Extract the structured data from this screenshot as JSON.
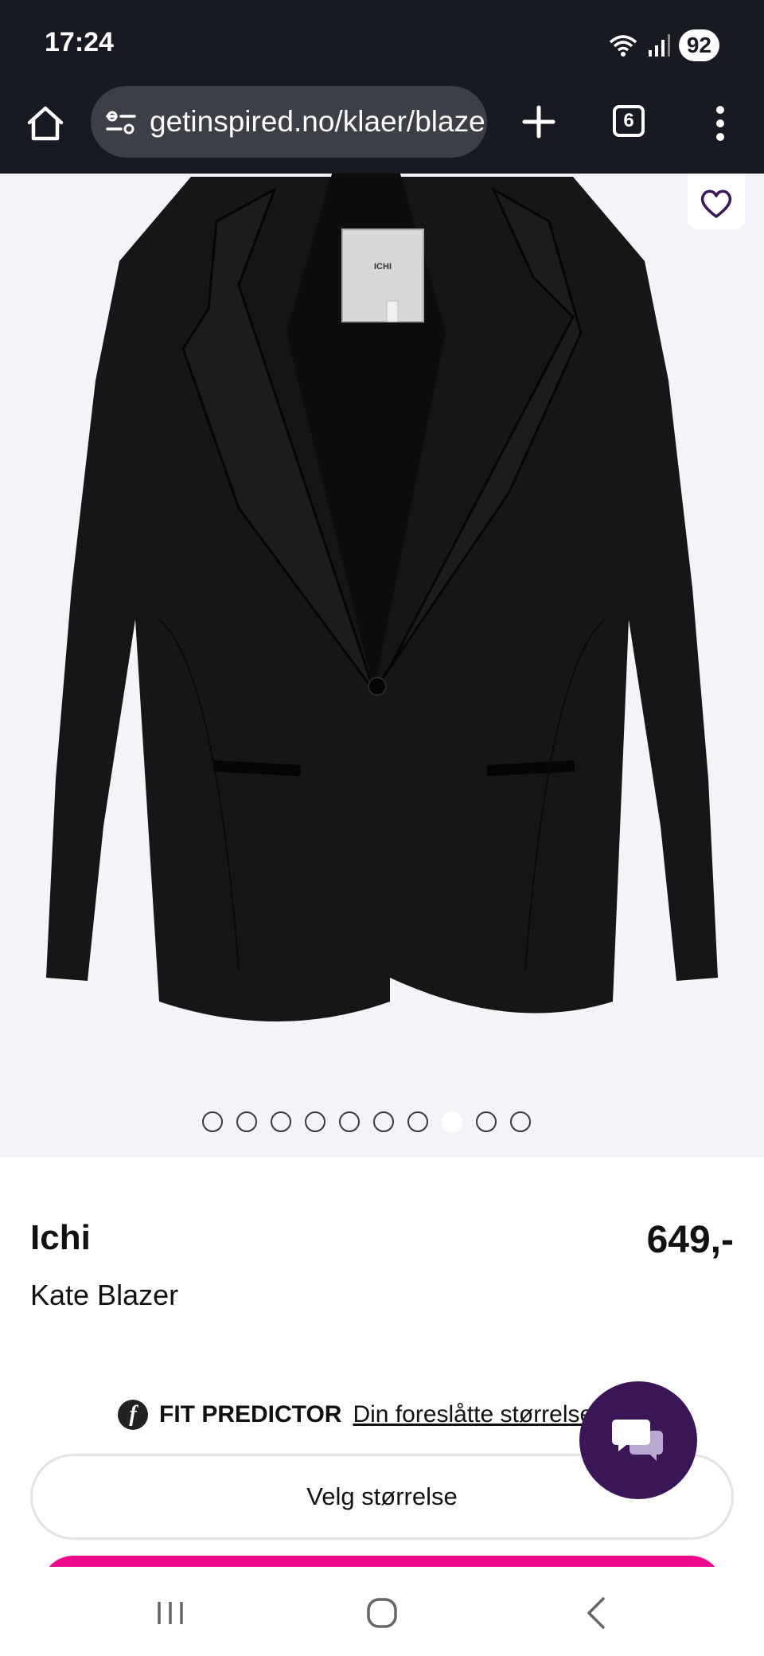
{
  "status_bar": {
    "time": "17:24",
    "battery": "92",
    "icons": [
      "wifi-icon",
      "signal-icon"
    ]
  },
  "browser": {
    "url": "getinspired.no/klaer/blazer",
    "tab_count": "6",
    "icons": [
      "home-icon",
      "site-settings-icon",
      "plus-icon",
      "tabs-icon",
      "more-vert-icon"
    ]
  },
  "gallery": {
    "image_count": 10,
    "active_index": 7,
    "tag_text": "ICHI",
    "icons": [
      "heart-icon"
    ]
  },
  "product": {
    "brand": "Ichi",
    "name": "Kate Blazer",
    "price": "649,-"
  },
  "fit_predictor": {
    "logo": "f",
    "label": "FIT PREDICTOR",
    "link": "Din foreslåtte størrelse"
  },
  "size_select": {
    "label": "Velg størrelse"
  },
  "colors": {
    "chat_button": "#3a1657",
    "buy_button": "#ec0b8c",
    "top_bar": "#171a21"
  },
  "nav_bar": {
    "icons": [
      "recent-apps-icon",
      "home-circle-icon",
      "back-icon"
    ]
  }
}
